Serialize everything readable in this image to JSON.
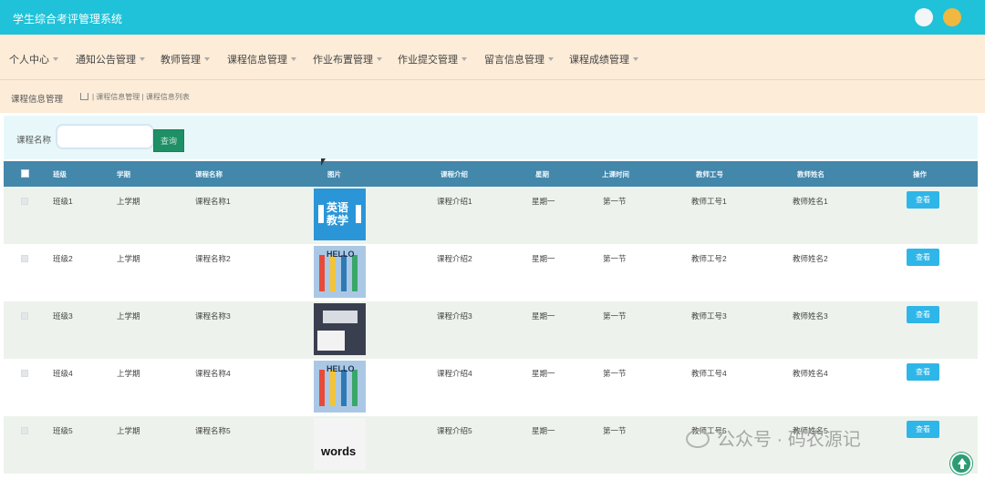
{
  "header": {
    "title": "学生综合考评管理系统"
  },
  "nav": {
    "items": [
      {
        "label": "个人中心"
      },
      {
        "label": "通知公告管理"
      },
      {
        "label": "教师管理"
      },
      {
        "label": "课程信息管理"
      },
      {
        "label": "作业布置管理"
      },
      {
        "label": "作业提交管理"
      },
      {
        "label": "留言信息管理"
      },
      {
        "label": "课程成绩管理"
      }
    ]
  },
  "breadcrumb": {
    "title": "课程信息管理",
    "path": "| 课程信息管理 | 课程信息列表"
  },
  "search": {
    "label": "课程名称",
    "value": "",
    "placeholder": "",
    "button_label": "查询"
  },
  "table": {
    "columns": [
      "班级",
      "学期",
      "课程名称",
      "图片",
      "课程介绍",
      "星期",
      "上课时间",
      "教师工号",
      "教师姓名",
      "操作"
    ],
    "rows": [
      {
        "class": "班级1",
        "term": "上学期",
        "course": "课程名称1",
        "intro": "课程介绍1",
        "weekday": "星期一",
        "time": "第一节",
        "teacher_id": "教师工号1",
        "teacher_name": "教师姓名1",
        "action": "查看",
        "image_text": "英语 教学"
      },
      {
        "class": "班级2",
        "term": "上学期",
        "course": "课程名称2",
        "intro": "课程介绍2",
        "weekday": "星期一",
        "time": "第一节",
        "teacher_id": "教师工号2",
        "teacher_name": "教师姓名2",
        "action": "查看",
        "image_text": "HELLO"
      },
      {
        "class": "班级3",
        "term": "上学期",
        "course": "课程名称3",
        "intro": "课程介绍3",
        "weekday": "星期一",
        "time": "第一节",
        "teacher_id": "教师工号3",
        "teacher_name": "教师姓名3",
        "action": "查看",
        "image_text": ""
      },
      {
        "class": "班级4",
        "term": "上学期",
        "course": "课程名称4",
        "intro": "课程介绍4",
        "weekday": "星期一",
        "time": "第一节",
        "teacher_id": "教师工号4",
        "teacher_name": "教师姓名4",
        "action": "查看",
        "image_text": "HELLO"
      },
      {
        "class": "班级5",
        "term": "上学期",
        "course": "课程名称5",
        "intro": "课程介绍5",
        "weekday": "星期一",
        "time": "第一节",
        "teacher_id": "教师工号5",
        "teacher_name": "教师姓名5",
        "action": "查看",
        "image_text": "words"
      }
    ]
  },
  "watermark": {
    "text": "公众号 · 码农源记"
  },
  "colors": {
    "header": "#1fc2d8",
    "nav_bg": "#fcecd8",
    "table_header": "#4387ab",
    "view_button": "#2fb6e8",
    "search_button": "#1f8f66"
  },
  "icons": {
    "fullscreen": "fullscreen-icon",
    "avatar": "avatar-icon",
    "back_to_top": "arrow-up-icon",
    "home": "home-icon"
  }
}
